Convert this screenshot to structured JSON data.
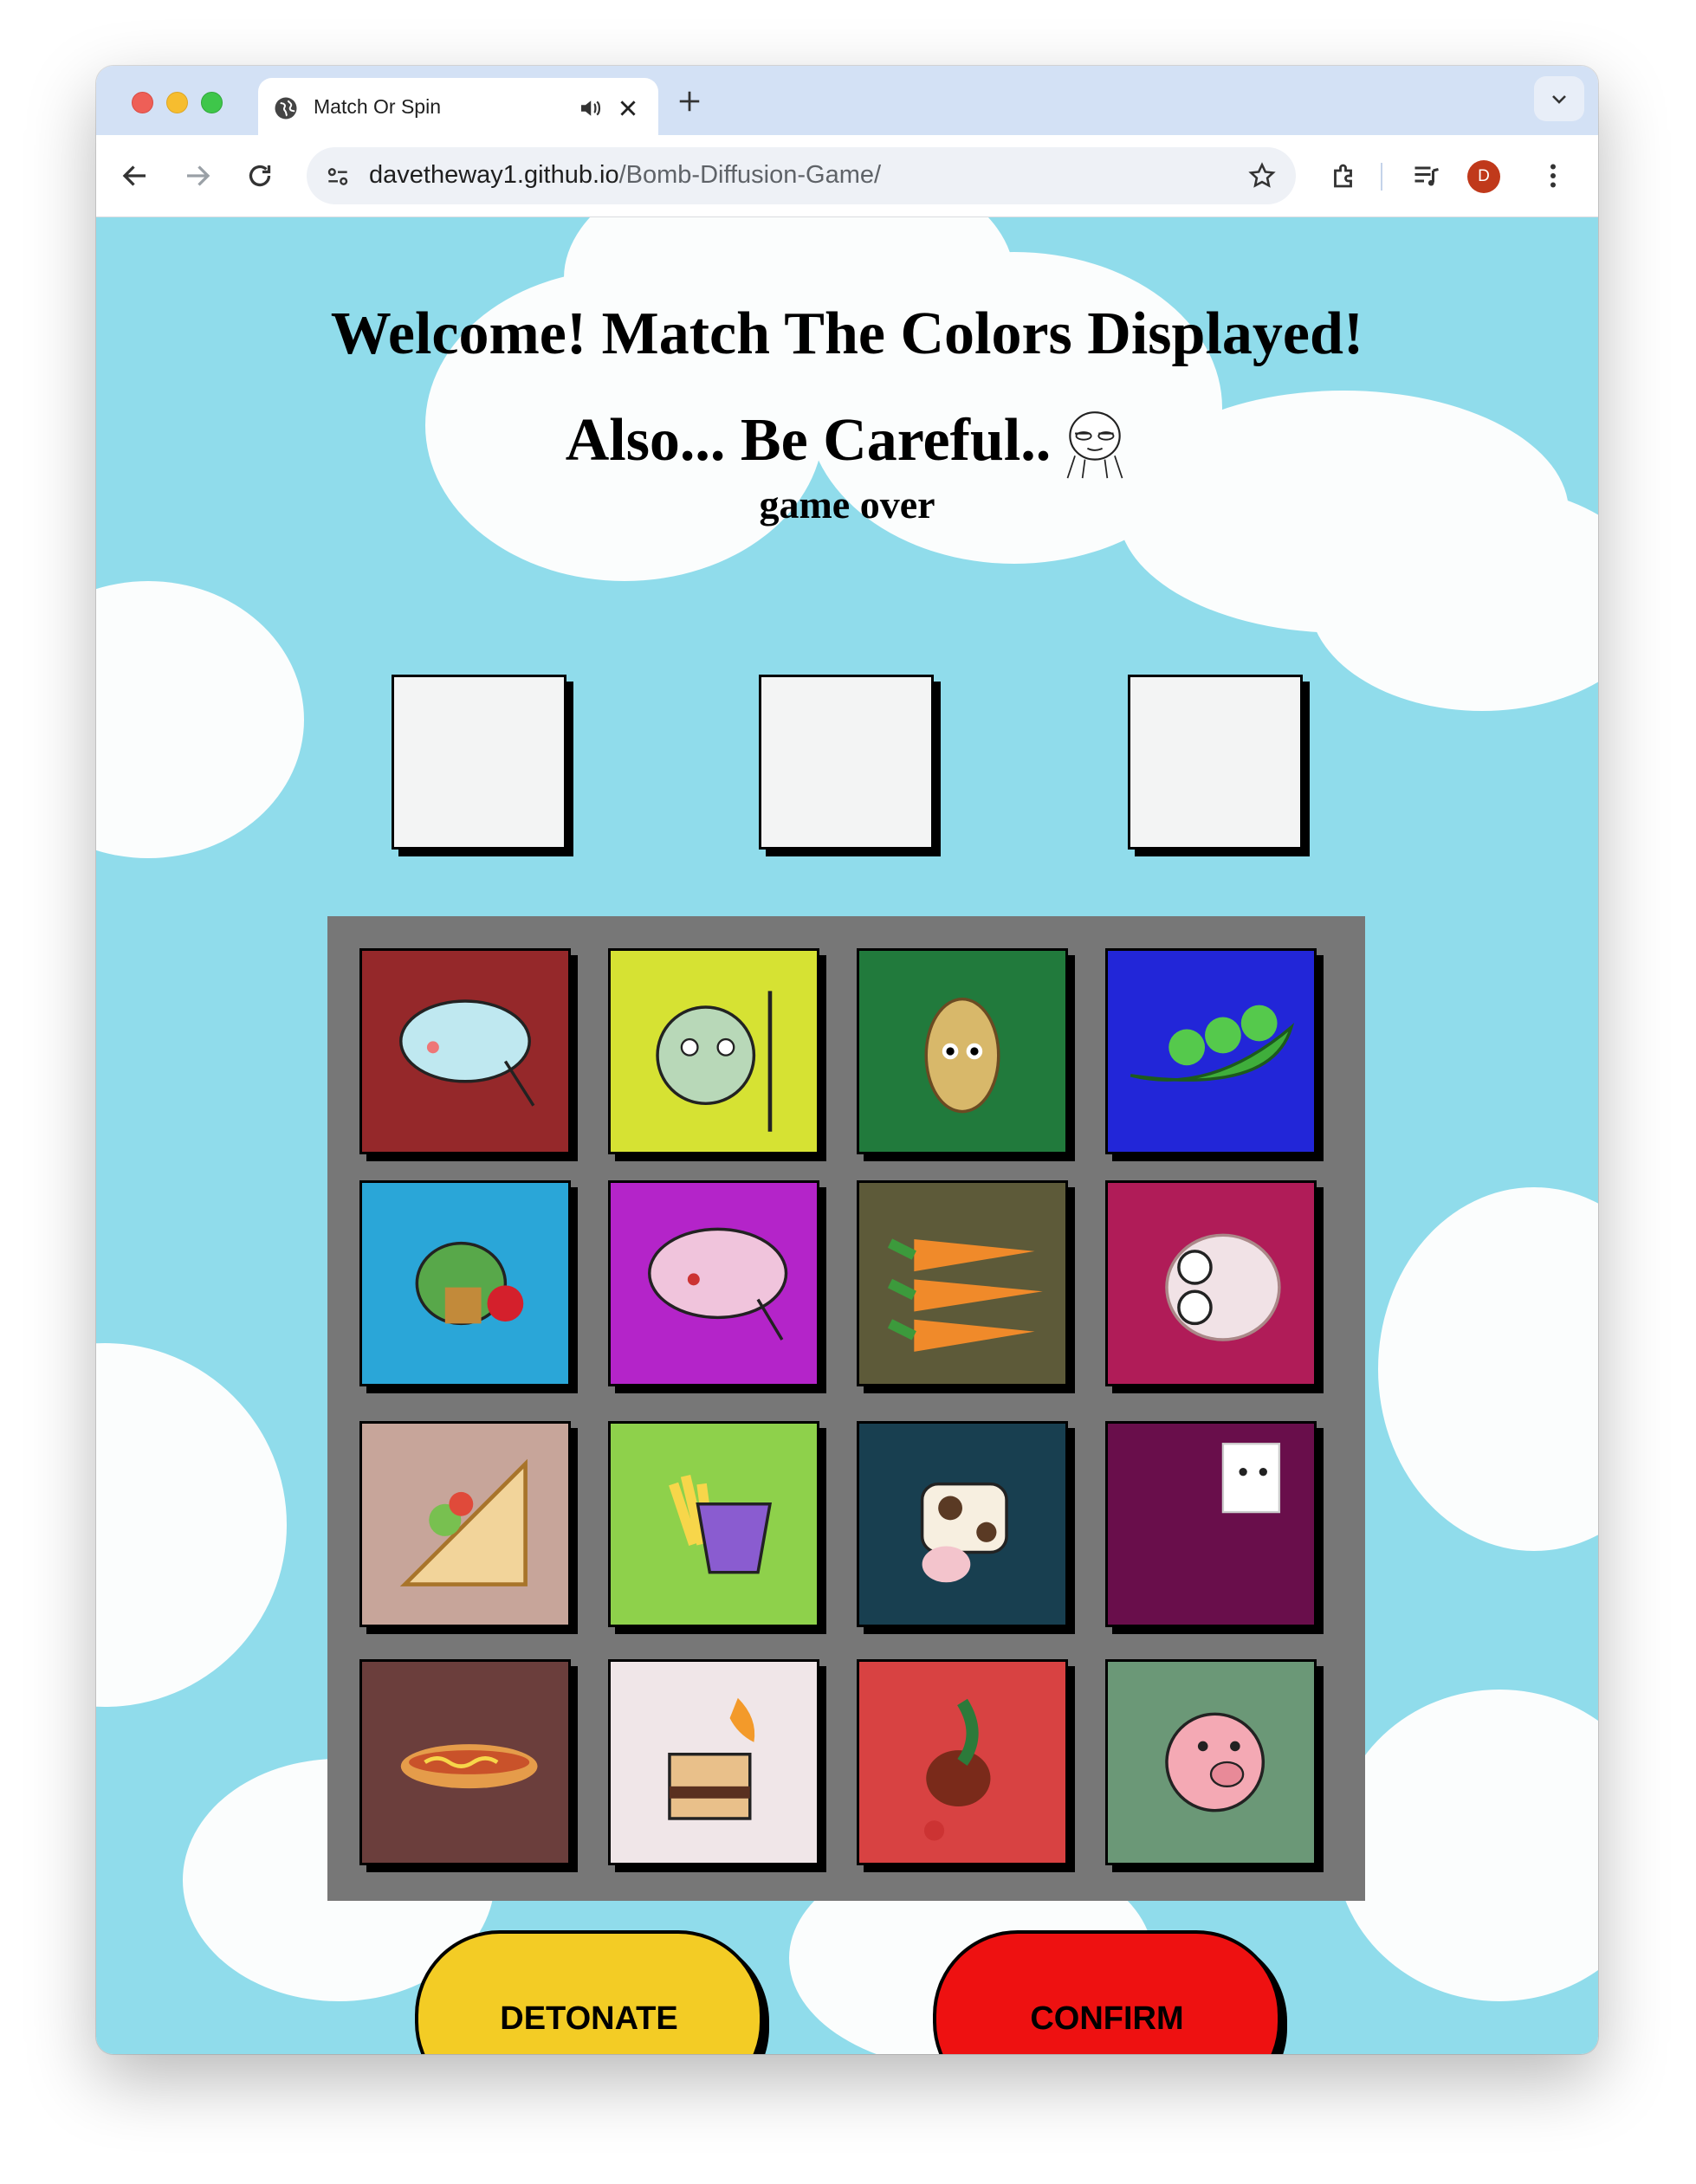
{
  "browser": {
    "tab_title": "Match Or Spin",
    "url_host": "davetheway1.github.io",
    "url_path": "/Bomb-Diffusion-Game/",
    "profile_initial": "D"
  },
  "page": {
    "heading_line1": "Welcome! Match The Colors Displayed!",
    "heading_line2": "Also... Be Careful..",
    "status": "game over",
    "target_slots": [
      "",
      "",
      ""
    ],
    "cards": [
      {
        "color": "#95282a",
        "icon": "blue-dinosaur"
      },
      {
        "color": "#d6e233",
        "icon": "peeking-dinosaur"
      },
      {
        "color": "#217a3c",
        "icon": "potato"
      },
      {
        "color": "#2226d8",
        "icon": "peas-in-pod"
      },
      {
        "color": "#2aa6d8",
        "icon": "green-dinosaur"
      },
      {
        "color": "#b424c9",
        "icon": "pink-dinosaur"
      },
      {
        "color": "#5d5a39",
        "icon": "carrots"
      },
      {
        "color": "#b01c58",
        "icon": "garlic"
      },
      {
        "color": "#c7a59a",
        "icon": "sandwich"
      },
      {
        "color": "#8ed14b",
        "icon": "french-fries"
      },
      {
        "color": "#183f50",
        "icon": "cow"
      },
      {
        "color": "#690e4b",
        "icon": "llama"
      },
      {
        "color": "#6b3e3c",
        "icon": "hotdog"
      },
      {
        "color": "#f0e6e8",
        "icon": "smores"
      },
      {
        "color": "#d84242",
        "icon": "rooster"
      },
      {
        "color": "#6b9877",
        "icon": "pig"
      }
    ],
    "buttons": {
      "detonate": "DETONATE",
      "confirm": "CONFIRM",
      "third": ""
    }
  }
}
